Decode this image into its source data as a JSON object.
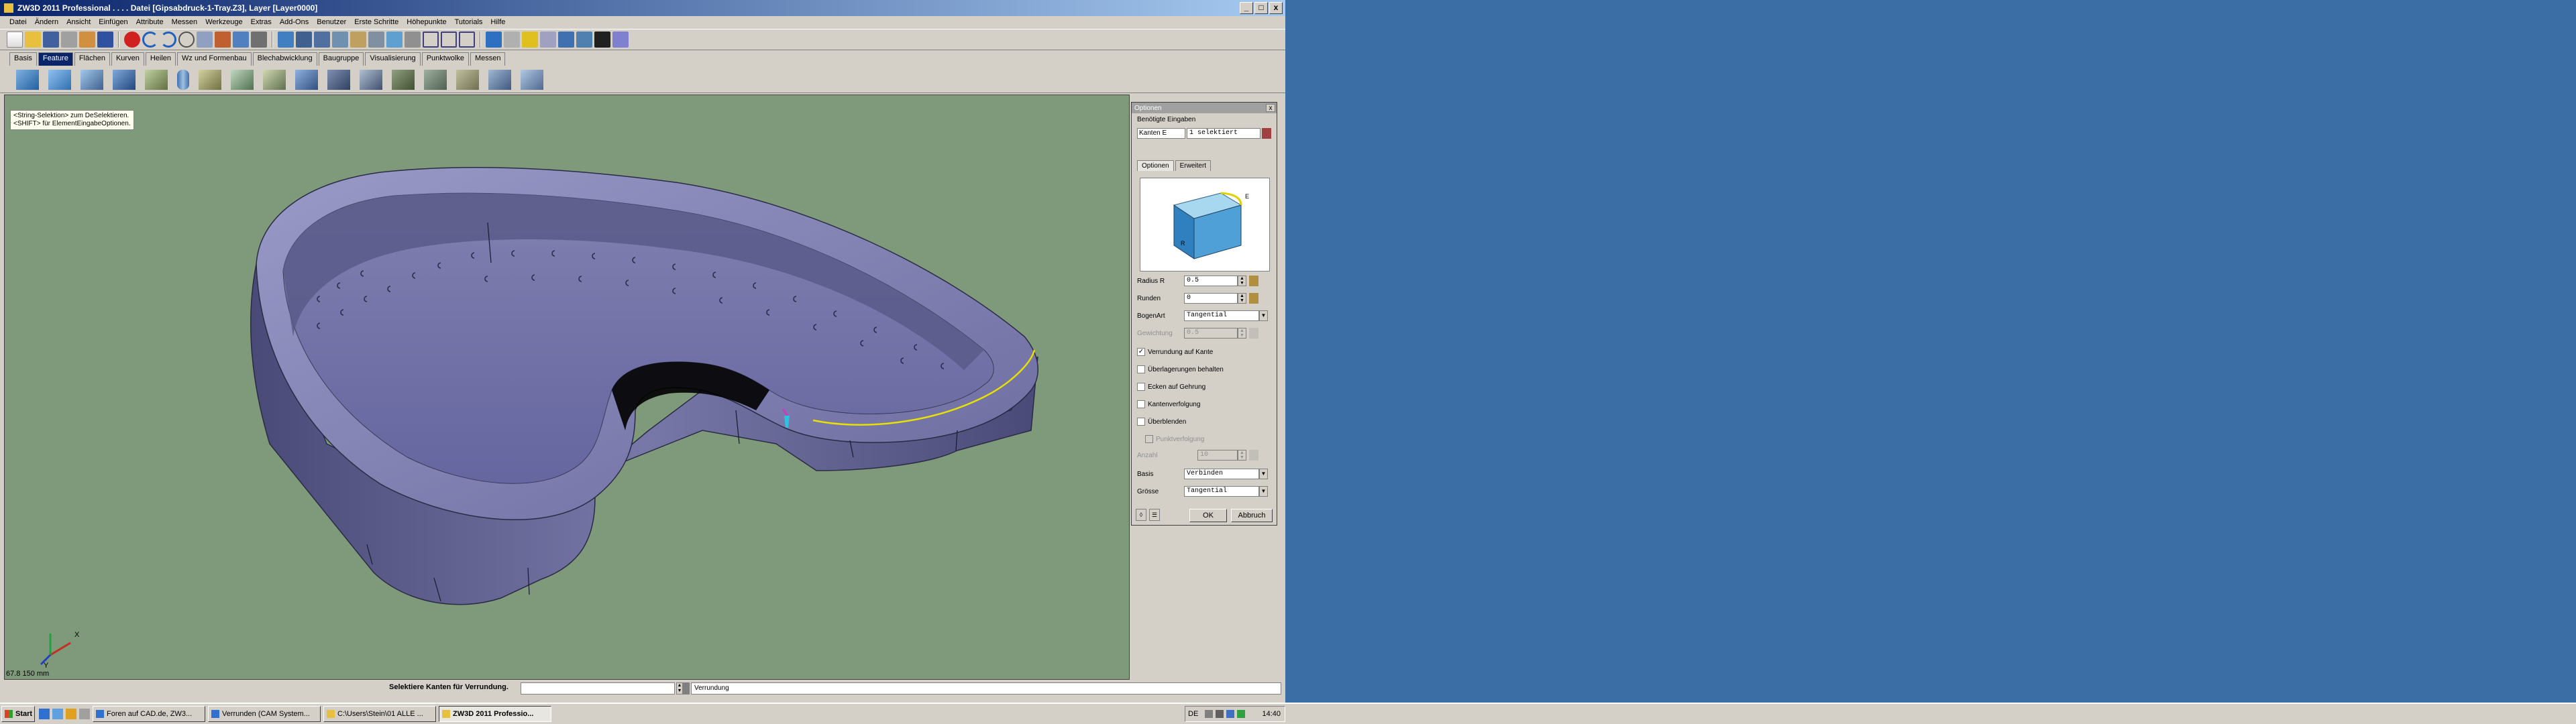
{
  "window": {
    "title": "ZW3D 2011 Professional        . . . . Datei [Gipsabdruck-1-Tray.Z3], Layer [Layer0000]",
    "min_label": "_",
    "max_label": "□",
    "close_label": "x"
  },
  "menu": [
    "Datei",
    "Ändern",
    "Ansicht",
    "Einfügen",
    "Attribute",
    "Messen",
    "Werkzeuge",
    "Extras",
    "Add-Ons",
    "Benutzer",
    "Erste Schritte",
    "Höhepunkte",
    "Tutorials",
    "Hilfe"
  ],
  "ribbon_tabs": [
    "Basis",
    "Feature",
    "Flächen",
    "Kurven",
    "Heilen",
    "Wz und Formenbau",
    "Blechabwicklung",
    "Baugruppe",
    "Visualisierung",
    "Punktwolke",
    "Messen"
  ],
  "ribbon_active": "Feature",
  "viewport": {
    "hint_lines": "<String-Selektion> zum DeSelektieren.\n<SHIFT> für ElementEingabeOptionen.",
    "coord_readout": "67.8 150 mm",
    "axis_x": "X",
    "axis_y": "Y"
  },
  "dialog": {
    "title": "Optionen",
    "close": "x",
    "required_label": "Benötigte Eingaben",
    "kanten_label": "Kanten E",
    "kanten_value": "1 selektiert",
    "tabs": [
      "Optionen",
      "Erweitert"
    ],
    "radius_label": "Radius R",
    "radius_value": "0.5",
    "runden_label": "Runden",
    "runden_value": "0",
    "bogenart_label": "BogenArt",
    "bogenart_value": "Tangential",
    "gewichtung_label": "Gewichtung",
    "gewichtung_value": "0.5",
    "checkboxes": [
      {
        "label": "Verrundung auf Kante",
        "checked": true
      },
      {
        "label": "Überlagerungen behalten",
        "checked": false
      },
      {
        "label": "Ecken auf Gehrung",
        "checked": false
      },
      {
        "label": "Kantenverfolgung",
        "checked": false
      },
      {
        "label": "Überblenden",
        "checked": false
      }
    ],
    "punktverfolg_label": "Punktverfolgung",
    "anzahl_label": "Anzahl",
    "anzahl_value": "10",
    "basis_label": "Basis",
    "basis_value": "Verbinden",
    "groesse_label": "Grösse",
    "groesse_value": "Tangential",
    "ok_label": "OK",
    "cancel_label": "Abbruch"
  },
  "status": {
    "prompt": "Selektiere Kanten für Verrundung.",
    "input_value": "",
    "message": "Verrundung"
  },
  "taskbar": {
    "start_label": "Start",
    "tasks": [
      {
        "label": "Foren auf CAD.de, ZW3...",
        "active": false
      },
      {
        "label": "Verrunden (CAM System...",
        "active": false
      },
      {
        "label": "C:\\Users\\Stein\\01 ALLE ...",
        "active": false
      },
      {
        "label": "ZW3D 2011 Professio...",
        "active": true
      }
    ],
    "lang": "DE",
    "clock": "14:40"
  },
  "colors": {
    "viewport_bg": "#7f9a7a",
    "part_body": "#6a6a9a",
    "selected_edge": "#e8e000",
    "desktop": "#3a6ea5"
  }
}
